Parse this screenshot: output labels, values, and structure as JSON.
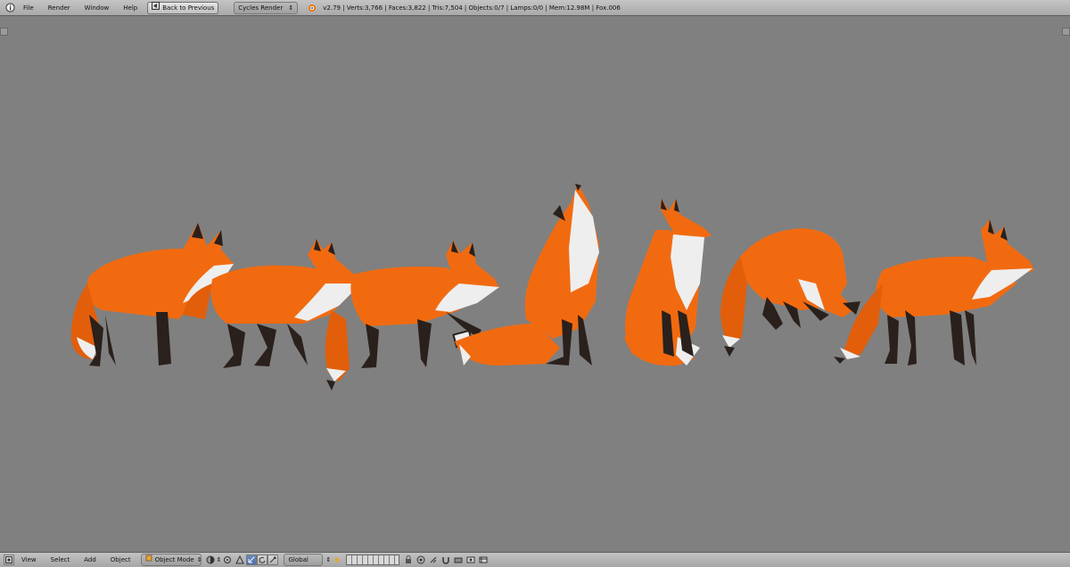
{
  "top_menu": {
    "info_icon": "info-icon",
    "items": [
      "File",
      "Render",
      "Window",
      "Help"
    ],
    "back_button": "Back to Previous",
    "engine": "Cycles Render",
    "stats": "v2.79 | Verts:3,766 | Faces:3,822 | Tris:7,504 | Objects:0/7 | Lamps:0/0 | Mem:12.98M | Fox.006"
  },
  "bottom_bar": {
    "items": [
      "View",
      "Select",
      "Add",
      "Object"
    ],
    "mode": "Object Mode",
    "orientation": "Global"
  },
  "viewport": {
    "background": "#808080",
    "fox_colors": {
      "orange": "#f26a10",
      "white": "#eeeeee",
      "dark": "#2a201c"
    },
    "foxes": [
      "standing",
      "walking",
      "pawing-box",
      "howling-seated",
      "sitting",
      "pouncing",
      "standing-alert"
    ]
  }
}
